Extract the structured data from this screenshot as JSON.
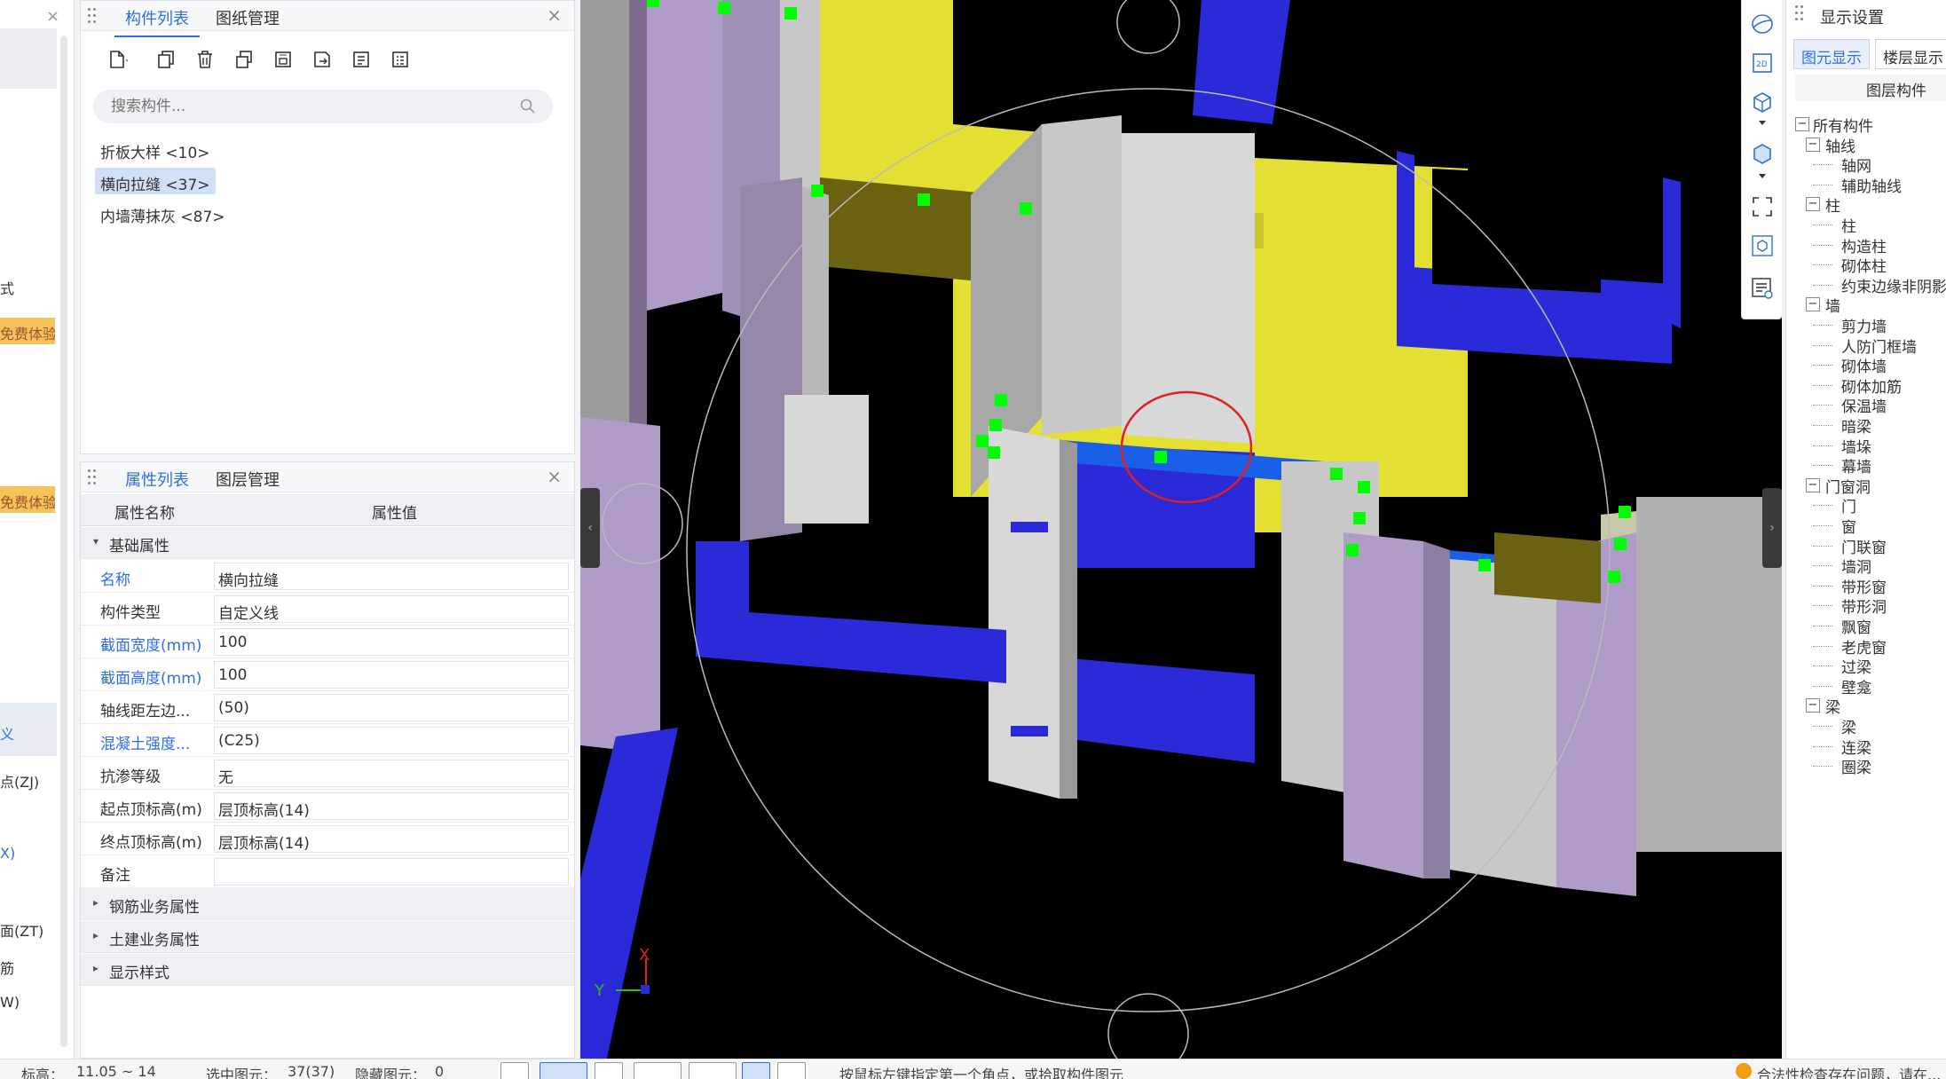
{
  "left_strip": {
    "items": [
      "式",
      "免费体验",
      "免费体验",
      "义",
      "点(ZJ)",
      "X)",
      "面(ZT)",
      "筋",
      "W)"
    ]
  },
  "component_panel": {
    "tabs": [
      "构件列表",
      "图纸管理"
    ],
    "close": "×",
    "toolbar_icons": [
      "new-component-icon",
      "copy-icon",
      "delete-icon",
      "duplicate-icon",
      "layer-copy-icon",
      "export-icon",
      "sort-icon",
      "filter-icon"
    ],
    "search_placeholder": "搜索构件...",
    "items": [
      "折板大样 <10>",
      "横向拉缝 <37>",
      "内墙薄抹灰 <87>"
    ],
    "selected_index": 1
  },
  "property_panel": {
    "tabs": [
      "属性列表",
      "图层管理"
    ],
    "close": "×",
    "col_name": "属性名称",
    "col_value": "属性值",
    "group_basic": "基础属性",
    "rows": [
      {
        "name": "名称",
        "value": "横向拉缝",
        "blue": true
      },
      {
        "name": "构件类型",
        "value": "自定义线",
        "blue": false
      },
      {
        "name": "截面宽度(mm)",
        "value": "100",
        "blue": true
      },
      {
        "name": "截面高度(mm)",
        "value": "100",
        "blue": true
      },
      {
        "name": "轴线距左边...",
        "value": "(50)",
        "blue": false
      },
      {
        "name": "混凝土强度...",
        "value": "(C25)",
        "blue": true
      },
      {
        "name": "抗渗等级",
        "value": "无",
        "blue": false
      },
      {
        "name": "起点顶标高(m)",
        "value": "层顶标高(14)",
        "blue": false
      },
      {
        "name": "终点顶标高(m)",
        "value": "层顶标高(14)",
        "blue": false
      },
      {
        "name": "备注",
        "value": "",
        "blue": false
      }
    ],
    "groups_collapsed": [
      "钢筋业务属性",
      "土建业务属性",
      "显示样式"
    ]
  },
  "viewport": {
    "axis_x": "X",
    "axis_y": "Y",
    "colors": {
      "background": "#000000",
      "slab": "#e3e033",
      "wall_purple": "#b09cc8",
      "wall_grey": "#c8c8c8",
      "beam_blue": "#2a2ad8",
      "seam": "#1a5fe8",
      "grip": "#00ff00",
      "highlight": "#e02020"
    }
  },
  "view_toolbar": {
    "icons": [
      "orbit-icon",
      "2d-icon",
      "3d-box-icon",
      "chevron-down-icon",
      "solid-box-icon",
      "chevron-down-icon",
      "fit-view-icon",
      "perspective-icon",
      "layer-settings-icon"
    ]
  },
  "display_panel": {
    "title": "显示设置",
    "tabs": [
      "图元显示",
      "楼层显示"
    ],
    "header": "图层构件",
    "tree": [
      {
        "label": "所有构件",
        "level": 0,
        "toggle": "−"
      },
      {
        "label": "轴线",
        "level": 1,
        "toggle": "−"
      },
      {
        "label": "轴网",
        "level": 2
      },
      {
        "label": "辅助轴线",
        "level": 2
      },
      {
        "label": "柱",
        "level": 1,
        "toggle": "−"
      },
      {
        "label": "柱",
        "level": 2
      },
      {
        "label": "构造柱",
        "level": 2
      },
      {
        "label": "砌体柱",
        "level": 2
      },
      {
        "label": "约束边缘非阴影",
        "level": 2
      },
      {
        "label": "墙",
        "level": 1,
        "toggle": "−"
      },
      {
        "label": "剪力墙",
        "level": 2
      },
      {
        "label": "人防门框墙",
        "level": 2
      },
      {
        "label": "砌体墙",
        "level": 2
      },
      {
        "label": "砌体加筋",
        "level": 2
      },
      {
        "label": "保温墙",
        "level": 2
      },
      {
        "label": "暗梁",
        "level": 2
      },
      {
        "label": "墙垛",
        "level": 2
      },
      {
        "label": "幕墙",
        "level": 2
      },
      {
        "label": "门窗洞",
        "level": 1,
        "toggle": "−"
      },
      {
        "label": "门",
        "level": 2
      },
      {
        "label": "窗",
        "level": 2
      },
      {
        "label": "门联窗",
        "level": 2
      },
      {
        "label": "墙洞",
        "level": 2
      },
      {
        "label": "带形窗",
        "level": 2
      },
      {
        "label": "带形洞",
        "level": 2
      },
      {
        "label": "飘窗",
        "level": 2
      },
      {
        "label": "老虎窗",
        "level": 2
      },
      {
        "label": "过梁",
        "level": 2
      },
      {
        "label": "壁龛",
        "level": 2
      },
      {
        "label": "梁",
        "level": 1,
        "toggle": "−"
      },
      {
        "label": "梁",
        "level": 2
      },
      {
        "label": "连梁",
        "level": 2
      },
      {
        "label": "圈梁",
        "level": 2
      }
    ]
  },
  "statusbar": {
    "elevation_label": "标高：",
    "elevation_value": "11.05 ~ 14",
    "selected_label": "选中图元：",
    "selected_value": "37(37)",
    "hidden_label": "隐藏图元：",
    "hidden_value": "0",
    "hint": "按鼠标左键指定第一个角点，或拾取构件图元",
    "warning": "合法性检查存在问题，请在..."
  }
}
